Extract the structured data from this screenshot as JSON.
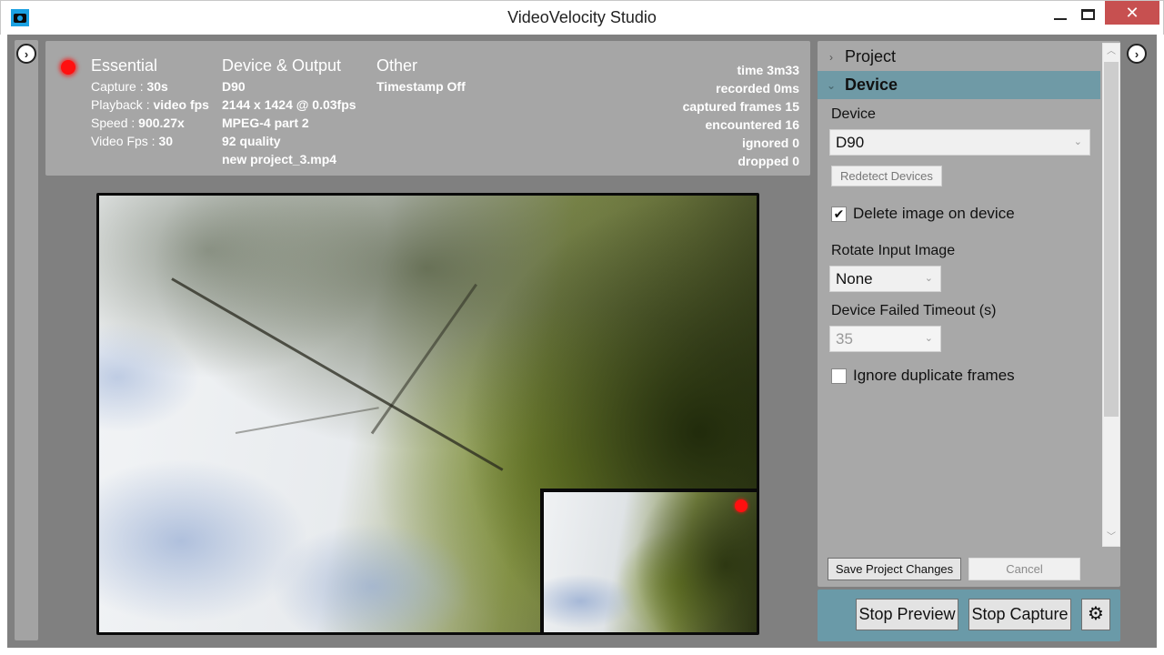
{
  "window": {
    "title": "VideoVelocity Studio",
    "minimize_icon": "minimize-icon",
    "maximize_icon": "maximize-icon",
    "close_icon": "close-icon",
    "close_glyph": "✕"
  },
  "toggles": {
    "left_glyph": "›",
    "right_glyph": "›"
  },
  "info": {
    "recording_indicator_color": "#ff1010",
    "essential": {
      "heading": "Essential",
      "rows": [
        {
          "label": "Capture : ",
          "value": "30s"
        },
        {
          "label": "Playback : ",
          "value": "video fps"
        },
        {
          "label": "Speed : ",
          "value": "900.27x"
        },
        {
          "label": "Video Fps : ",
          "value": "30"
        }
      ]
    },
    "device_output": {
      "heading": "Device & Output",
      "lines": [
        "D90",
        "2144 x 1424 @ 0.03fps",
        "MPEG-4 part 2",
        "92 quality",
        "new project_3.mp4"
      ]
    },
    "other": {
      "heading": "Other",
      "lines": [
        "Timestamp Off"
      ]
    },
    "stats": [
      "time 3m33",
      "recorded 0ms",
      "captured frames 15",
      "encountered 16",
      "ignored 0",
      "dropped 0"
    ]
  },
  "settings": {
    "sections": [
      {
        "label": "Project",
        "expanded": false,
        "chevron": "›"
      },
      {
        "label": "Device",
        "expanded": true,
        "chevron": "⌄"
      }
    ],
    "device_label": "Device",
    "device_value": "D90",
    "redetect_label": "Redetect Devices",
    "delete_image": {
      "label": "Delete image on device",
      "checked": true,
      "mark": "✔"
    },
    "rotate_label": "Rotate Input Image",
    "rotate_value": "None",
    "timeout_label": "Device Failed Timeout (s)",
    "timeout_value": "35",
    "ignore_duplicates": {
      "label": "Ignore duplicate frames",
      "checked": false
    },
    "dropdown_arrow": "⌄",
    "scroll_up": "︿",
    "scroll_down": "﹀"
  },
  "footer": {
    "save_label": "Save Project Changes",
    "cancel_label": "Cancel"
  },
  "actions": {
    "stop_preview_label": "Stop Preview",
    "stop_capture_label": "Stop Capture",
    "settings_glyph": "⚙"
  },
  "colors": {
    "accent_header": "#6f9aa6",
    "action_bar": "#6a9aa8",
    "close_button": "#c75050"
  }
}
